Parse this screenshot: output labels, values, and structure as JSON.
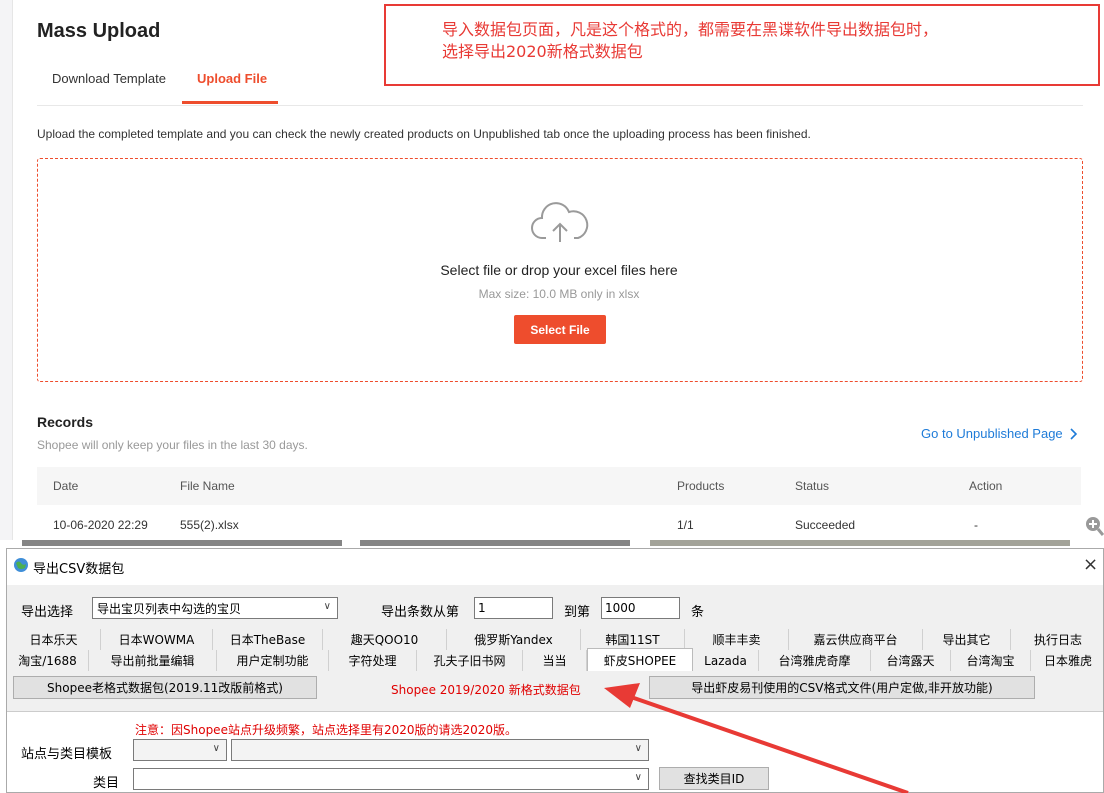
{
  "web": {
    "title": "Mass Upload",
    "tabs": [
      {
        "label": "Download Template",
        "active": false
      },
      {
        "label": "Upload File",
        "active": true
      }
    ],
    "description": "Upload the completed template and you can check the newly created products on Unpublished tab once the uploading process has been finished.",
    "dropzone": {
      "title": "Select file or drop your excel files here",
      "hint": "Max size: 10.0 MB only in xlsx",
      "button": "Select File"
    },
    "records": {
      "title": "Records",
      "subtitle": "Shopee will only keep your files in the last 30 days.",
      "link": "Go to Unpublished Page",
      "columns": [
        "Date",
        "File Name",
        "Products",
        "Status",
        "Action"
      ],
      "rows": [
        {
          "date": "10-06-2020 22:29",
          "file": "555(2).xlsx",
          "products": "1/1",
          "status": "Succeeded",
          "action": "-"
        }
      ]
    },
    "accent": "#ee4d2d",
    "link_color": "#1e7bd8"
  },
  "callout": {
    "line1": "导入数据包页面，凡是这个格式的，都需要在黑谍软件导出数据包时，",
    "line2": "选择导出2020新格式数据包",
    "color": "#e83a35"
  },
  "dialog": {
    "title": "导出CSV数据包",
    "close": "×",
    "export_select_label": "导出选择",
    "export_select_value": "导出宝贝列表中勾选的宝贝",
    "count_label": "导出条数从第",
    "count_from": "1",
    "count_to_label": "到第",
    "count_to": "1000",
    "count_unit": "条",
    "tabs_row1": [
      "日本乐天",
      "日本WOWMA",
      "日本TheBase",
      "趣天QOO10",
      "俄罗斯Yandex",
      "韩国11ST",
      "顺丰丰卖",
      "嘉云供应商平台",
      "导出其它",
      "执行日志"
    ],
    "tabs_row2": [
      "淘宝/1688",
      "导出前批量编辑",
      "用户定制功能",
      "字符处理",
      "孔夫子旧书网",
      "当当",
      "虾皮SHOPEE",
      "Lazada",
      "台湾雅虎奇摩",
      "台湾露天",
      "台湾淘宝",
      "日本雅虎"
    ],
    "selected_tab": "虾皮SHOPEE",
    "subtab_old": "Shopee老格式数据包(2019.11改版前格式)",
    "subtab_new": "Shopee 2019/2020 新格式数据包",
    "subtab_csv": "导出虾皮易刊使用的CSV格式文件(用户定做,非开放功能)",
    "notice": "注意：因Shopee站点升级频繁，站点选择里有2020版的请选2020版。",
    "site_label": "站点与类目模板",
    "category_label": "类目",
    "find_button": "查找类目ID"
  }
}
